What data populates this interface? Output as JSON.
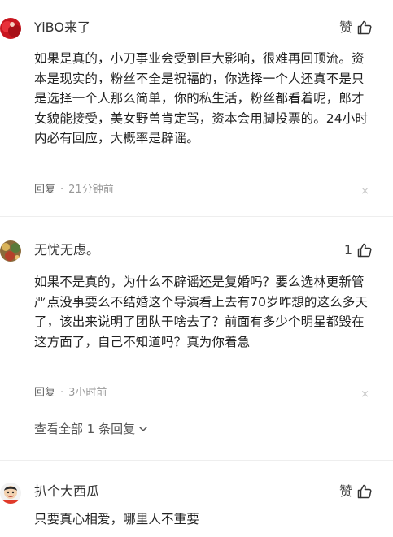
{
  "comments": [
    {
      "username": "YiBO来了",
      "like_label": "赞",
      "text": "如果是真的，小刀事业会受到巨大影响，很难再回顶流。资本是现实的，粉丝不全是祝福的，你选择一个人还真不是只是选择一个人那么简单，你的私生活，粉丝都看着呢，郎才女貌能接受，美女野兽肯定骂，资本会用脚投票的。24小时内必有回应，大概率是辟谣。",
      "reply_label": "回复",
      "time": "21分钟前",
      "close_glyph": "×"
    },
    {
      "username": "无忧无虑。",
      "like_label": "1",
      "text": "如果不是真的，为什么不辟谣还是复婚吗？要么选林更新管严点没事要么不结婚这个导演看上去有70岁咋想的这么多天了，该出来说明了团队干啥去了？前面有多少个明星都毁在这方面了，自己不知道吗？真为你着急",
      "reply_label": "回复",
      "time": "3小时前",
      "close_glyph": "×",
      "view_replies": "查看全部 1 条回复"
    },
    {
      "username": "扒个大西瓜",
      "like_label": "赞",
      "text": "只要真心相爱，哪里人不重要"
    }
  ],
  "colors": {
    "text": "#222222",
    "meta": "#999999",
    "divider": "#eeeeee"
  }
}
